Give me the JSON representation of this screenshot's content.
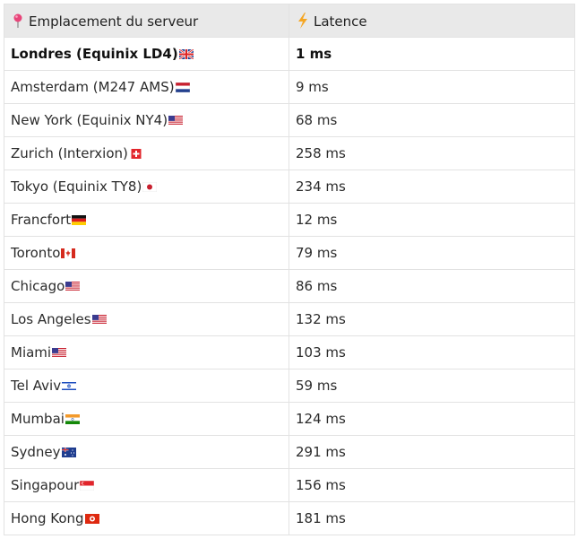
{
  "header": {
    "location": "Emplacement du serveur",
    "latency": "Latence",
    "location_icon": "pin-icon",
    "latency_icon": "lightning-icon"
  },
  "rows": [
    {
      "location": "Londres (Equinix LD4)",
      "flag": "uk",
      "latency": "1 ms",
      "bold": true
    },
    {
      "location": "Amsterdam (M247 AMS)",
      "flag": "nl",
      "latency": "9 ms"
    },
    {
      "location": "New York (Equinix NY4)",
      "flag": "us",
      "latency": "68 ms"
    },
    {
      "location": "Zurich (Interxion)",
      "flag": "ch",
      "latency": "258 ms"
    },
    {
      "location": "Tokyo (Equinix TY8)",
      "flag": "jp",
      "latency": "234 ms"
    },
    {
      "location": "Francfort",
      "flag": "de",
      "latency": "12 ms"
    },
    {
      "location": "Toronto",
      "flag": "ca",
      "latency": "79 ms"
    },
    {
      "location": "Chicago",
      "flag": "us",
      "latency": "86 ms"
    },
    {
      "location": "Los Angeles",
      "flag": "us",
      "latency": "132 ms"
    },
    {
      "location": "Miami",
      "flag": "us",
      "latency": "103 ms"
    },
    {
      "location": "Tel Aviv",
      "flag": "il",
      "latency": "59 ms"
    },
    {
      "location": "Mumbai",
      "flag": "in",
      "latency": "124 ms"
    },
    {
      "location": "Sydney",
      "flag": "au",
      "latency": "291 ms"
    },
    {
      "location": "Singapour",
      "flag": "sg",
      "latency": "156 ms"
    },
    {
      "location": "Hong Kong",
      "flag": "hk",
      "latency": "181 ms"
    }
  ]
}
